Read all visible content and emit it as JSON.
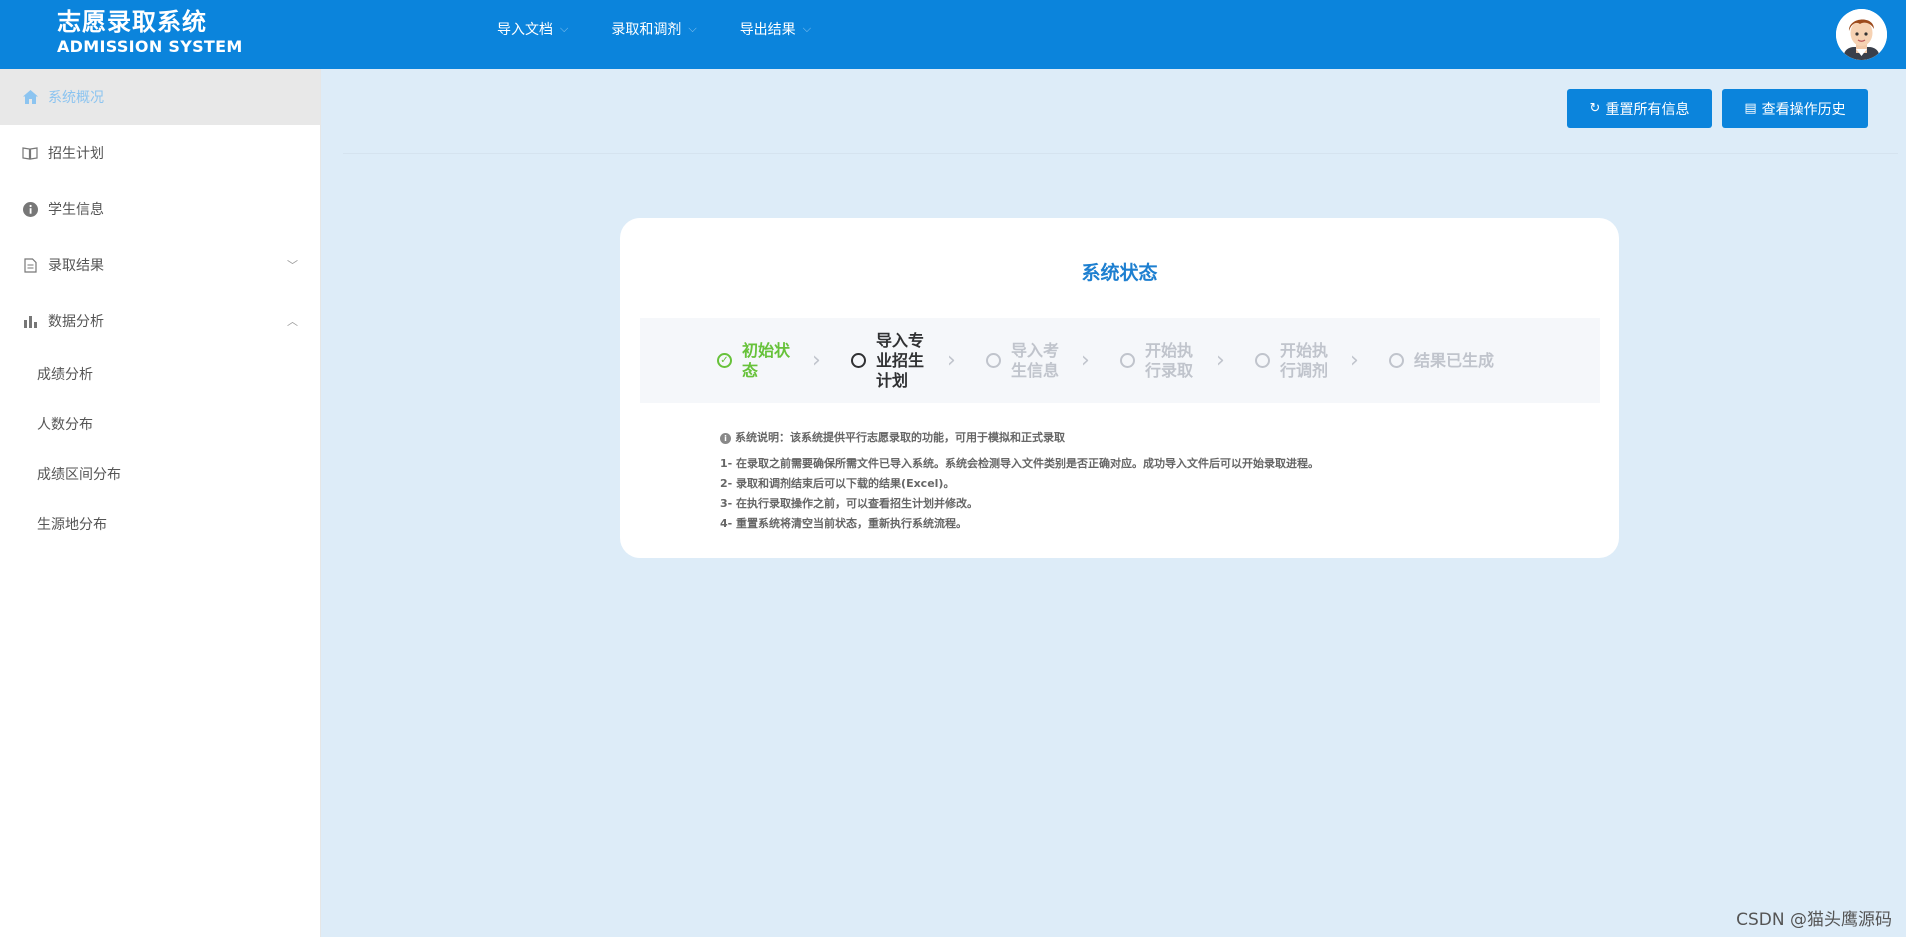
{
  "header": {
    "title_cn": "志愿录取系统",
    "title_en": "ADMISSION SYSTEM",
    "nav": [
      {
        "label": "导入文档"
      },
      {
        "label": "录取和调剂"
      },
      {
        "label": "导出结果"
      }
    ]
  },
  "sidebar": {
    "items": [
      {
        "label": "系统概况",
        "icon": "home-icon"
      },
      {
        "label": "招生计划",
        "icon": "book-icon"
      },
      {
        "label": "学生信息",
        "icon": "info-icon"
      },
      {
        "label": "录取结果",
        "icon": "document-icon"
      },
      {
        "label": "数据分析",
        "icon": "bar-chart-icon"
      }
    ],
    "submenu": [
      {
        "label": "成绩分析"
      },
      {
        "label": "人数分布"
      },
      {
        "label": "成绩区间分布"
      },
      {
        "label": "生源地分布"
      }
    ]
  },
  "toolbar": {
    "reset_label": "重置所有信息",
    "history_label": "查看操作历史"
  },
  "status_card": {
    "title": "系统状态",
    "steps": [
      {
        "label": "初始状态",
        "state": "done"
      },
      {
        "label": "导入专业招生计划",
        "state": "current"
      },
      {
        "label": "导入考生信息",
        "state": "wait"
      },
      {
        "label": "开始执行录取",
        "state": "wait"
      },
      {
        "label": "开始执行调剂",
        "state": "wait"
      },
      {
        "label": "结果已生成",
        "state": "wait"
      }
    ],
    "note_title": "系统说明：该系统提供平行志愿录取的功能，可用于模拟和正式录取",
    "notes": [
      "1- 在录取之前需要确保所需文件已导入系统。系统会检测导入文件类别是否正确对应。成功导入文件后可以开始录取进程。",
      "2- 录取和调剂结束后可以下载的结果(Excel)。",
      "3- 在执行录取操作之前，可以查看招生计划并修改。",
      "4- 重置系统将清空当前状态，重新执行系统流程。"
    ]
  },
  "watermark": "CSDN @猫头鹰源码",
  "colors": {
    "header": "#0b84dc",
    "background": "#ddecf8",
    "done": "#67c23a",
    "title": "#1d7fd0"
  }
}
